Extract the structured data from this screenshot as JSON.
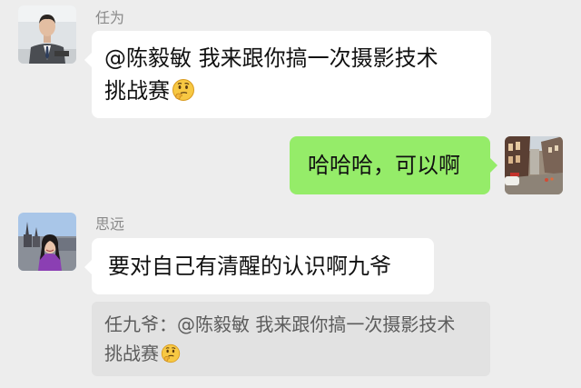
{
  "messages": [
    {
      "sender": "任为",
      "side": "left",
      "lines": [
        "@陈毅敏  我来跟你搞一次摄影技术",
        "挑战赛"
      ],
      "emoji": "thinking-emoji"
    },
    {
      "side": "right",
      "text": "哈哈哈，可以啊"
    },
    {
      "sender": "思远",
      "side": "left",
      "text": "要对自己有清醒的认识啊九爷",
      "quote": {
        "lines": [
          "任九爷：@陈毅敏 我来跟你搞一次摄影技术",
          "挑战赛"
        ],
        "emoji": "thinking-emoji"
      }
    }
  ],
  "colors": {
    "background": "#ededed",
    "incoming_bubble": "#ffffff",
    "outgoing_bubble": "#95ec69",
    "quote_background": "#e2e2e2"
  }
}
